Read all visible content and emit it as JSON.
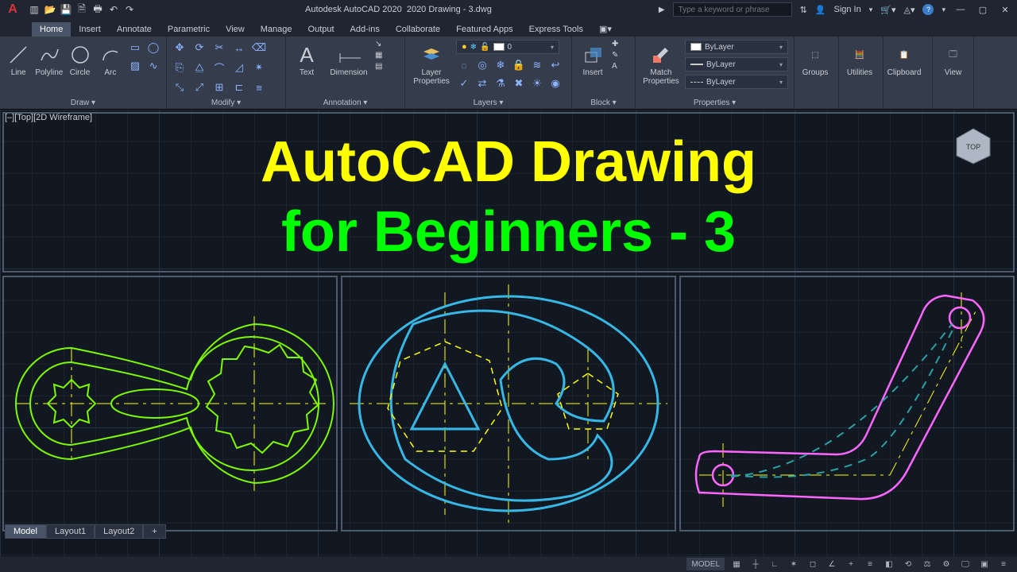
{
  "app": {
    "product": "Autodesk AutoCAD 2020",
    "file": "2020 Drawing - 3.dwg"
  },
  "search": {
    "placeholder": "Type a keyword or phrase"
  },
  "signin": "Sign In",
  "tabs": [
    "Home",
    "Insert",
    "Annotate",
    "Parametric",
    "View",
    "Manage",
    "Output",
    "Add-ins",
    "Collaborate",
    "Featured Apps",
    "Express Tools"
  ],
  "ribbon": {
    "draw": {
      "title": "Draw ▾",
      "tools": [
        "Line",
        "Polyline",
        "Circle",
        "Arc"
      ]
    },
    "modify": {
      "title": "Modify ▾"
    },
    "annotation": {
      "title": "Annotation ▾",
      "text": "Text",
      "dim": "Dimension"
    },
    "layers": {
      "title": "Layers ▾",
      "btn": "Layer Properties",
      "current": "0"
    },
    "block": {
      "title": "Block ▾",
      "insert": "Insert"
    },
    "properties": {
      "title": "Properties ▾",
      "match": "Match Properties",
      "bylayer": "ByLayer"
    },
    "groups": "Groups",
    "utilities": "Utilities",
    "clipboard": "Clipboard",
    "view": "View"
  },
  "viewctl": "[–][Top][2D Wireframe]",
  "overlay": {
    "line1": "AutoCAD Drawing",
    "line2": "for Beginners - 3"
  },
  "layouts": [
    "Model",
    "Layout1",
    "Layout2"
  ],
  "status": {
    "mode": "MODEL"
  },
  "colors": {
    "yellow": "#ffff00",
    "green": "#00ff00",
    "lime": "#7df900",
    "cyan": "#36b7e6",
    "magenta": "#ff66ff",
    "teal": "#2aa0a3"
  }
}
